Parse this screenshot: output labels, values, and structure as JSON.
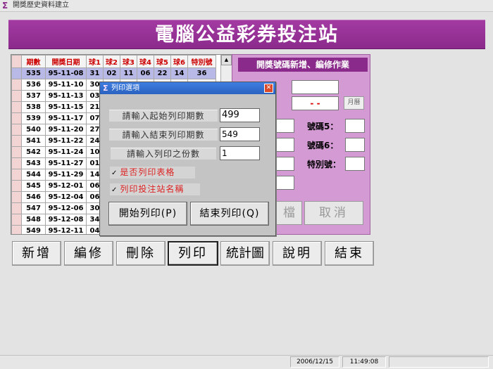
{
  "window": {
    "title": "開獎歷史資料建立"
  },
  "banner": {
    "text": "電腦公益彩券投注站"
  },
  "grid": {
    "headers": [
      "期數",
      "開獎日期",
      "球1",
      "球2",
      "球3",
      "球4",
      "球5",
      "球6",
      "特別號"
    ],
    "rows": [
      [
        "535",
        "95-11-08",
        "31",
        "02",
        "11",
        "06",
        "22",
        "14",
        "36"
      ],
      [
        "536",
        "95-11-10",
        "30",
        "",
        "",
        "",
        "",
        "",
        ""
      ],
      [
        "537",
        "95-11-13",
        "03",
        "",
        "",
        "",
        "",
        "",
        ""
      ],
      [
        "538",
        "95-11-15",
        "21",
        "",
        "",
        "",
        "",
        "",
        ""
      ],
      [
        "539",
        "95-11-17",
        "07",
        "",
        "",
        "",
        "",
        "",
        ""
      ],
      [
        "540",
        "95-11-20",
        "27",
        "",
        "",
        "",
        "",
        "",
        ""
      ],
      [
        "541",
        "95-11-22",
        "24",
        "",
        "",
        "",
        "",
        "",
        ""
      ],
      [
        "542",
        "95-11-24",
        "10",
        "",
        "",
        "",
        "",
        "",
        ""
      ],
      [
        "543",
        "95-11-27",
        "01",
        "",
        "",
        "",
        "",
        "",
        ""
      ],
      [
        "544",
        "95-11-29",
        "14",
        "",
        "",
        "",
        "",
        "",
        ""
      ],
      [
        "545",
        "95-12-01",
        "06",
        "",
        "",
        "",
        "",
        "",
        ""
      ],
      [
        "546",
        "95-12-04",
        "06",
        "",
        "",
        "",
        "",
        "",
        ""
      ],
      [
        "547",
        "95-12-06",
        "30",
        "",
        "",
        "",
        "",
        "",
        ""
      ],
      [
        "548",
        "95-12-08",
        "34",
        "",
        "",
        "",
        "",
        "",
        ""
      ],
      [
        "549",
        "95-12-11",
        "04",
        "",
        "",
        "",
        "",
        "",
        ""
      ]
    ]
  },
  "right_panel": {
    "title": "開獎號碼新增、編修作業",
    "date_value": "- -",
    "calendar_button": "月曆",
    "label_num5": "號碼5：",
    "label_num6": "號碼6：",
    "label_special": "特別號：",
    "save_button_partial": "檔",
    "cancel_button": "取消"
  },
  "toolbar": {
    "add": "新增",
    "edit": "編修",
    "delete": "刪除",
    "print": "列印",
    "chart": "統計圖",
    "help": "說明",
    "exit": "結束"
  },
  "dialog": {
    "title": "列印選項",
    "close": "✕",
    "start_label": "請輸入起始列印期數",
    "start_value": "499",
    "end_label": "請輸入結束列印期數",
    "end_value": "549",
    "copies_label": "請輸入列印之份數",
    "copies_value": "1",
    "check_table": "是否列印表格",
    "check_station": "列印投注站名稱",
    "check_mark": "✓",
    "start_button": "開始列印(P)",
    "end_button": "結束列印(Q)"
  },
  "statusbar": {
    "date": "2006/12/15",
    "time": "11:49:08"
  }
}
